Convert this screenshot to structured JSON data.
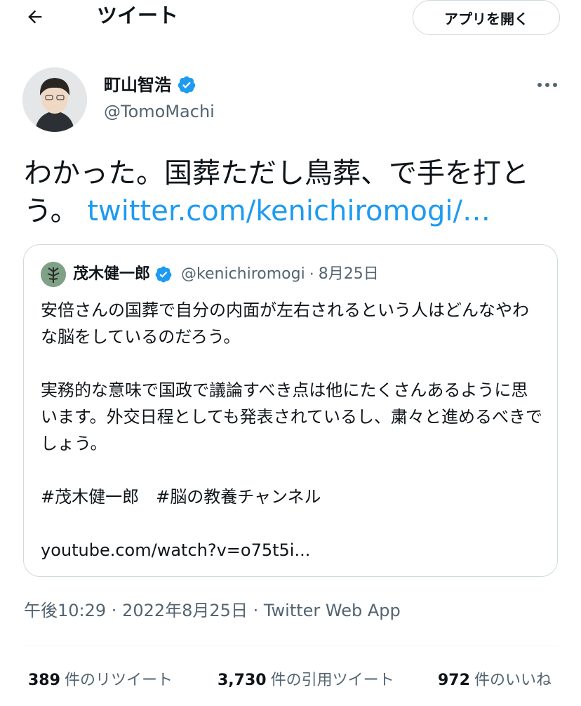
{
  "header": {
    "title": "ツイート",
    "open_app_label": "アプリを開く"
  },
  "author": {
    "name": "町山智浩",
    "handle": "@TomoMachi"
  },
  "tweet": {
    "text": "わかった。国葬ただし鳥葬、で手を打とう。",
    "link": "twitter.com/kenichiromogi/…"
  },
  "quote": {
    "name": "茂木健一郎",
    "handle": "@kenichiromogi",
    "separator": "·",
    "date": "8月25日",
    "paragraphs": [
      "安倍さんの国葬で自分の内面が左右されるという人はどんなやわな脳をしているのだろう。",
      "実務的な意味で国政で議論すべき点は他にたくさんあるように思います。外交日程としても発表されているし、粛々と進めるべきでしょう。",
      "#茂木健一郎　#脳の教養チャンネル",
      "youtube.com/watch?v=o75t5i..."
    ]
  },
  "meta": {
    "time": "午後10:29",
    "separator1": " · ",
    "date": "2022年8月25日",
    "separator2": " · ",
    "source": "Twitter Web App"
  },
  "stats": {
    "retweets_count": "389",
    "retweets_label": "件のリツイート",
    "quotes_count": "3,730",
    "quotes_label": "件の引用ツイート",
    "likes_count": "972",
    "likes_label": "件のいいね"
  },
  "colors": {
    "link": "#1d9bf0",
    "secondary_text": "#536471",
    "border": "#cfd9de",
    "verified": "#1d9bf0"
  },
  "icons": {
    "back": "arrow-left-icon",
    "verified": "verified-badge-icon",
    "more": "more-horizontal-icon"
  }
}
